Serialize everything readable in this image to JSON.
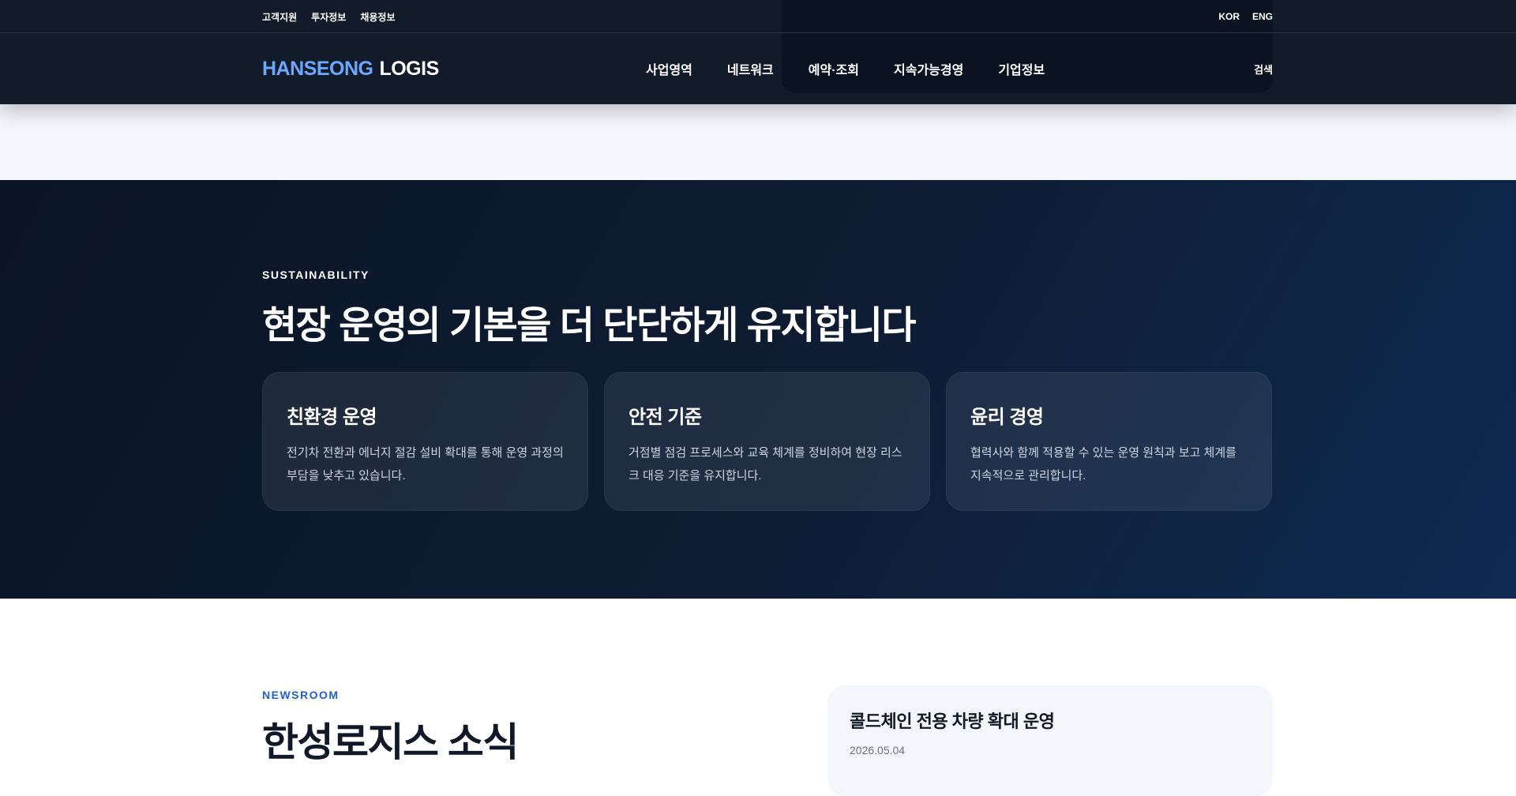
{
  "header": {
    "utility_links": [
      "고객지원",
      "투자정보",
      "채용정보"
    ],
    "languages": [
      "KOR",
      "ENG"
    ],
    "logo": {
      "brand": "HANSEONG",
      "sub": "LOGIS"
    },
    "nav": [
      "사업영역",
      "네트워크",
      "예약·조회",
      "지속가능경영",
      "기업정보"
    ],
    "search_label": "검색"
  },
  "sustainability": {
    "eyebrow": "SUSTAINABILITY",
    "title": "현장 운영의 기본을 더 단단하게 유지합니다",
    "cards": [
      {
        "title": "친환경 운영",
        "text": "전기차 전환과 에너지 절감 설비 확대를 통해 운영 과정의 부담을 낮추고 있습니다."
      },
      {
        "title": "안전 기준",
        "text": "거점별 점검 프로세스와 교육 체계를 정비하여 현장 리스크 대응 기준을 유지합니다."
      },
      {
        "title": "윤리 경영",
        "text": "협력사와 함께 적용할 수 있는 운영 원칙과 보고 체계를 지속적으로 관리합니다."
      }
    ]
  },
  "newsroom": {
    "eyebrow": "NEWSROOM",
    "title": "한성로지스 소식",
    "featured": {
      "headline": "콜드체인 전용 차량 확대 운영",
      "date": "2026.05.04"
    }
  },
  "colors": {
    "header_bg": "#121b29",
    "brand_accent": "#6aa9ff",
    "section_dark": "#0f1d34",
    "news_accent": "#1f5fd1"
  }
}
